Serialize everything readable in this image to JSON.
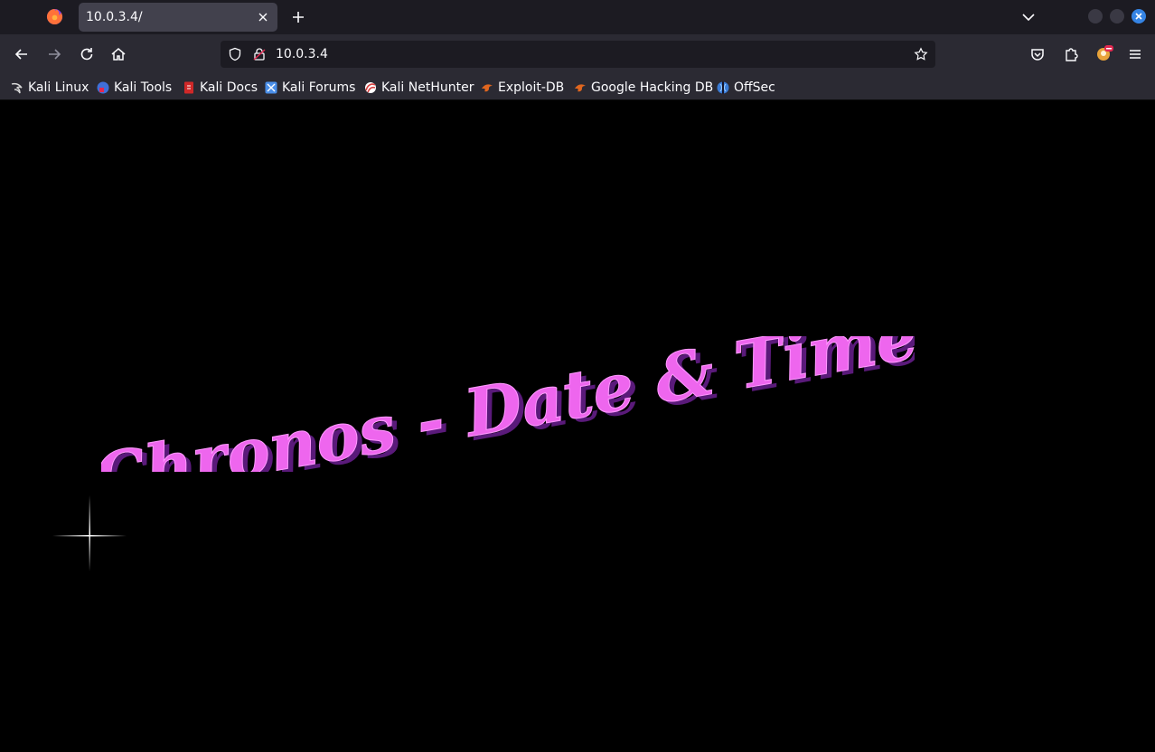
{
  "browser": {
    "tab_title": "10.0.3.4/",
    "url": "10.0.3.4",
    "icons": [
      "firefox-logo-icon",
      "close-icon",
      "plus-icon",
      "chevron-down-icon",
      "back-icon",
      "forward-icon",
      "reload-icon",
      "home-icon",
      "shield-icon",
      "lock-icon",
      "star-icon",
      "pocket-icon",
      "extensions-icon",
      "account-icon",
      "menu-icon"
    ]
  },
  "bookmarks": [
    {
      "label": "Kali Linux",
      "icon": "kali-dragon-icon",
      "color": "#d8d8d8"
    },
    {
      "label": "Kali Tools",
      "icon": "kali-tools-icon",
      "color": "#3f6fd8"
    },
    {
      "label": "Kali Docs",
      "icon": "kali-docs-icon",
      "color": "#d02828"
    },
    {
      "label": "Kali Forums",
      "icon": "kali-forums-icon",
      "color": "#4a8ee8"
    },
    {
      "label": "Kali NetHunter",
      "icon": "nethunter-icon",
      "color": "#d84040"
    },
    {
      "label": "Exploit-DB",
      "icon": "exploit-db-icon",
      "color": "#e0661f"
    },
    {
      "label": "Google Hacking DB",
      "icon": "ghdb-icon",
      "color": "#e0661f"
    },
    {
      "label": "OffSec",
      "icon": "offsec-icon",
      "color": "#3a7bd5"
    }
  ],
  "page": {
    "headline": "Chronos - Date & Time",
    "headline_color": "#ee66ee",
    "headline_shadow": "#5a1a7a",
    "background": "#000000"
  }
}
